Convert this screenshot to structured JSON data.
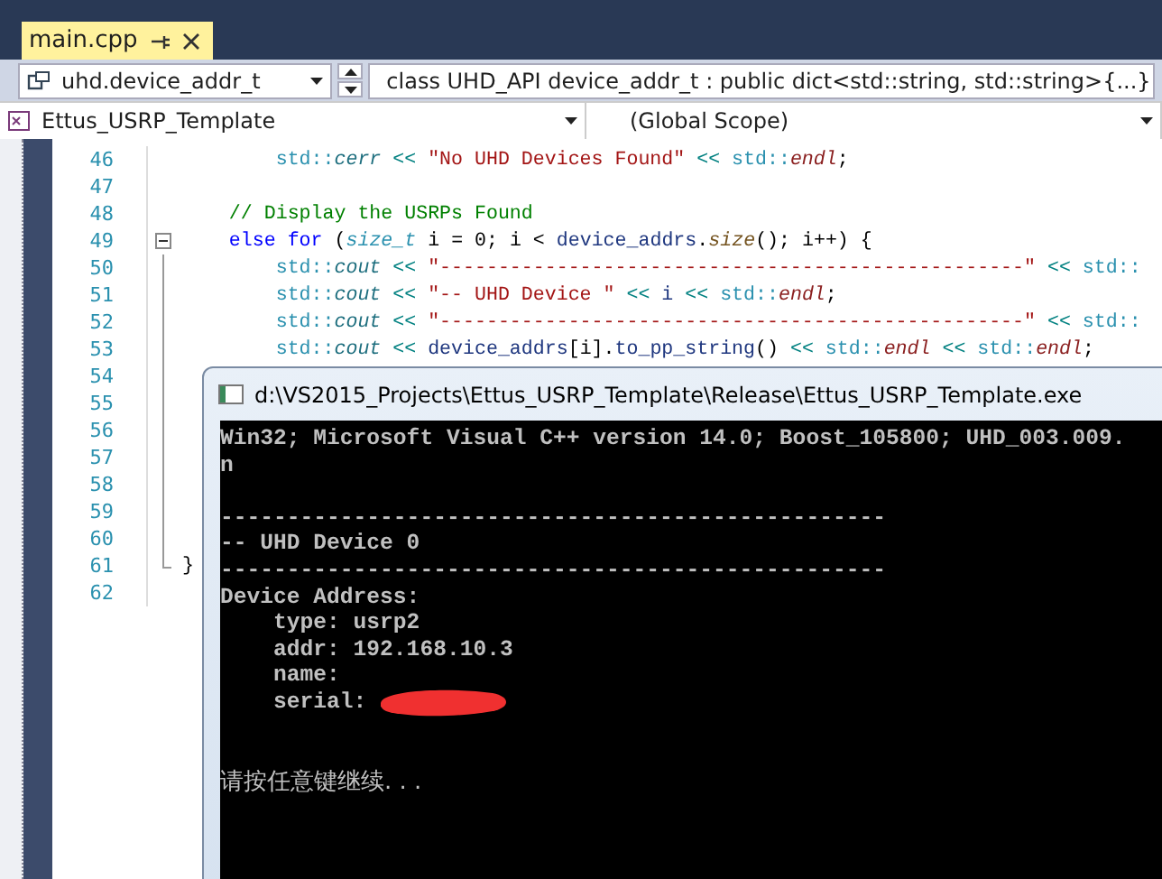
{
  "tab": {
    "title": "main.cpp",
    "selected": true
  },
  "navigation": {
    "type_combo": "uhd.device_addr_t",
    "member_combo": "class UHD_API device_addr_t : public dict<std::string, std::string>{...}",
    "project_combo": "Ettus_USRP_Template",
    "scope_combo": "(Global Scope)"
  },
  "code": {
    "lines": [
      {
        "number": "46",
        "tokens": [
          {
            "text": "        std::",
            "kind": "ns"
          },
          {
            "text": "cerr",
            "kind": "global"
          },
          {
            "text": " << ",
            "kind": "op"
          },
          {
            "text": "\"No UHD Devices Found\"",
            "kind": "str"
          },
          {
            "text": " << ",
            "kind": "op"
          },
          {
            "text": "std::",
            "kind": "ns"
          },
          {
            "text": "endl",
            "kind": "macro"
          },
          {
            "text": ";",
            "kind": "plain"
          }
        ]
      },
      {
        "number": "47"
      },
      {
        "number": "48",
        "tokens": [
          {
            "text": "    // Display the USRPs Found",
            "kind": "comment"
          }
        ]
      },
      {
        "number": "49",
        "expanded": true,
        "tokens": [
          {
            "text": "    else for",
            "kind": "kw"
          },
          {
            "text": " (",
            "kind": "plain"
          },
          {
            "text": "size_t",
            "kind": "type"
          },
          {
            "text": " i = 0; i < ",
            "kind": "plain"
          },
          {
            "text": "device_addrs",
            "kind": "ident"
          },
          {
            "text": ".",
            "kind": "plain"
          },
          {
            "text": "size",
            "kind": "fn"
          },
          {
            "text": "(); i++) {",
            "kind": "plain"
          }
        ]
      },
      {
        "number": "50",
        "tokens": [
          {
            "text": "        std::",
            "kind": "ns"
          },
          {
            "text": "cout",
            "kind": "global"
          },
          {
            "text": " << ",
            "kind": "op"
          },
          {
            "text": "\"--------------------------------------------------\"",
            "kind": "str"
          },
          {
            "text": " << ",
            "kind": "op"
          },
          {
            "text": "std::",
            "kind": "ns"
          }
        ]
      },
      {
        "number": "51",
        "tokens": [
          {
            "text": "        std::",
            "kind": "ns"
          },
          {
            "text": "cout",
            "kind": "global"
          },
          {
            "text": " << ",
            "kind": "op"
          },
          {
            "text": "\"-- UHD Device \"",
            "kind": "str"
          },
          {
            "text": " << ",
            "kind": "op"
          },
          {
            "text": "i",
            "kind": "ident"
          },
          {
            "text": " << ",
            "kind": "op"
          },
          {
            "text": "std::",
            "kind": "ns"
          },
          {
            "text": "endl",
            "kind": "macro"
          },
          {
            "text": ";",
            "kind": "plain"
          }
        ]
      },
      {
        "number": "52",
        "tokens": [
          {
            "text": "        std::",
            "kind": "ns"
          },
          {
            "text": "cout",
            "kind": "global"
          },
          {
            "text": " << ",
            "kind": "op"
          },
          {
            "text": "\"--------------------------------------------------\"",
            "kind": "str"
          },
          {
            "text": " << ",
            "kind": "op"
          },
          {
            "text": "std::",
            "kind": "ns"
          }
        ]
      },
      {
        "number": "53",
        "tokens": [
          {
            "text": "        std::",
            "kind": "ns"
          },
          {
            "text": "cout",
            "kind": "global"
          },
          {
            "text": " << ",
            "kind": "op"
          },
          {
            "text": "device_addrs",
            "kind": "ident"
          },
          {
            "text": "[i].",
            "kind": "plain"
          },
          {
            "text": "to_pp_string",
            "kind": "ident"
          },
          {
            "text": "()",
            "kind": "plain"
          },
          {
            "text": " << ",
            "kind": "op"
          },
          {
            "text": "std::",
            "kind": "ns"
          },
          {
            "text": "endl",
            "kind": "macro"
          },
          {
            "text": " << ",
            "kind": "op"
          },
          {
            "text": "std::",
            "kind": "ns"
          },
          {
            "text": "endl",
            "kind": "macro"
          },
          {
            "text": ";",
            "kind": "plain"
          }
        ]
      },
      {
        "number": "54"
      },
      {
        "number": "55"
      },
      {
        "number": "56"
      },
      {
        "number": "57"
      },
      {
        "number": "58"
      },
      {
        "number": "59"
      },
      {
        "number": "60"
      },
      {
        "number": "61",
        "tokens": [
          {
            "text": "}",
            "kind": "plain"
          }
        ]
      },
      {
        "number": "62"
      }
    ]
  },
  "console": {
    "title": "d:\\VS2015_Projects\\Ettus_USRP_Template\\Release\\Ettus_USRP_Template.exe",
    "lines": [
      {
        "kind": "text",
        "text": "Win32; Microsoft Visual C++ version 14.0; Boost_105800; UHD_003.009."
      },
      {
        "kind": "text",
        "text": "n"
      },
      {
        "kind": "blank"
      },
      {
        "kind": "text",
        "text": "--------------------------------------------------"
      },
      {
        "kind": "text",
        "text": "-- UHD Device 0"
      },
      {
        "kind": "text",
        "text": "--------------------------------------------------"
      },
      {
        "kind": "text",
        "text": "Device Address:"
      },
      {
        "kind": "text",
        "text": "    type: usrp2"
      },
      {
        "kind": "text",
        "text": "    addr: 192.168.10.3"
      },
      {
        "kind": "text",
        "text": "    name:"
      },
      {
        "kind": "redacted",
        "text": "    serial:"
      },
      {
        "kind": "blank"
      },
      {
        "kind": "blank"
      },
      {
        "kind": "text",
        "text": "请按任意键继续. . ."
      }
    ]
  }
}
